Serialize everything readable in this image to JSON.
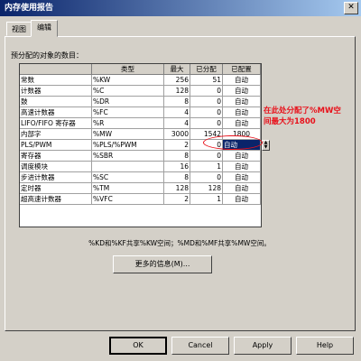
{
  "window": {
    "title": "内存使用报告",
    "close_glyph": "✕"
  },
  "tabs": [
    {
      "label": "视图"
    },
    {
      "label": "编辑"
    }
  ],
  "section_label": "预分配的对象的数目：",
  "table": {
    "headers": [
      "",
      "类型",
      "最大",
      "已分配",
      "已配置"
    ],
    "rows": [
      {
        "name": "常数",
        "type": "%KW",
        "max": "256",
        "allocated": "51",
        "configured": "自动"
      },
      {
        "name": "计数器",
        "type": "%C",
        "max": "128",
        "allocated": "0",
        "configured": "自动"
      },
      {
        "name": "鼓",
        "type": "%DR",
        "max": "8",
        "allocated": "0",
        "configured": "自动"
      },
      {
        "name": "高速计数器",
        "type": "%FC",
        "max": "4",
        "allocated": "0",
        "configured": "自动"
      },
      {
        "name": "LIFO/FIFO 寄存器",
        "type": "%R",
        "max": "4",
        "allocated": "0",
        "configured": "自动"
      },
      {
        "name": "内部字",
        "type": "%MW",
        "max": "3000",
        "allocated": "1542",
        "configured": "1800"
      },
      {
        "name": "PLS/PWM",
        "type": "%PLS/%PWM",
        "max": "2",
        "allocated": "0",
        "configured": "自动"
      },
      {
        "name": "寄存器",
        "type": "%SBR",
        "max": "8",
        "allocated": "0",
        "configured": "自动"
      },
      {
        "name": "调度模块",
        "type": "",
        "max": "16",
        "allocated": "1",
        "configured": "自动"
      },
      {
        "name": "步进计数器",
        "type": "%SC",
        "max": "8",
        "allocated": "0",
        "configured": "自动"
      },
      {
        "name": "定时器",
        "type": "%TM",
        "max": "128",
        "allocated": "128",
        "configured": "自动"
      },
      {
        "name": "超高速计数器",
        "type": "%VFC",
        "max": "2",
        "allocated": "1",
        "configured": "自动"
      }
    ]
  },
  "annotation": "在此处分配了%MW空间最大为1800",
  "note": "%KD和%KF共享%KW空间；%MD和%MF共享%MW空间。",
  "more_button": "更多的信息(M)...",
  "buttons": {
    "ok": "OK",
    "cancel": "Cancel",
    "apply": "Apply",
    "help": "Help"
  },
  "colors": {
    "accent": "#0a246a",
    "annotation": "#e8101a"
  }
}
